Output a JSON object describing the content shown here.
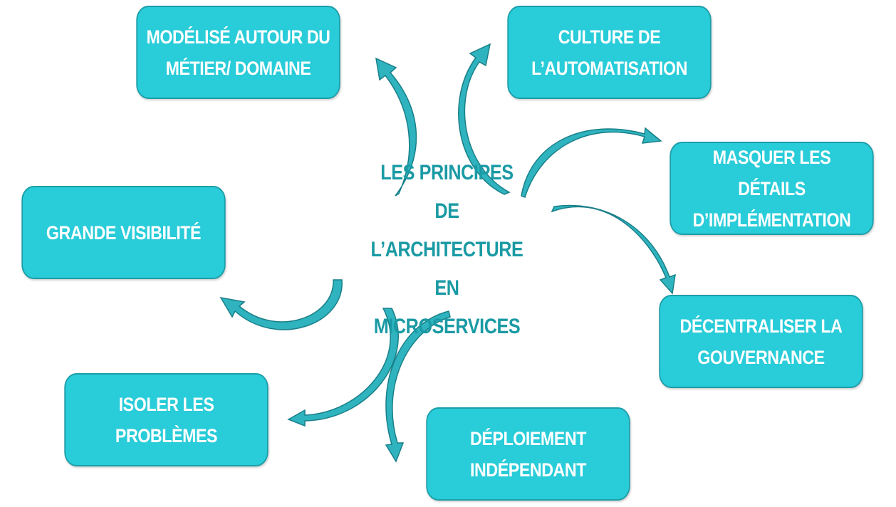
{
  "center": {
    "lines": [
      "LES PRINCIPES DE",
      "L’ARCHITECTURE EN",
      "MICROSERVICES"
    ]
  },
  "nodes": {
    "modelise": {
      "lines": [
        "MODÉLISÉ AUTOUR DU",
        "MÉTIER/ DOMAINE"
      ]
    },
    "culture": {
      "lines": [
        "CULTURE DE",
        "L’AUTOMATISATION"
      ]
    },
    "masquer": {
      "lines": [
        "MASQUER LES DÉTAILS",
        "D’IMPLÉMENTATION"
      ]
    },
    "grande": {
      "lines": [
        "GRANDE VISIBILITÉ"
      ]
    },
    "decentraliser": {
      "lines": [
        "DÉCENTRALISER LA",
        "GOUVERNANCE"
      ]
    },
    "isoler": {
      "lines": [
        "ISOLER LES PROBLÈMES"
      ]
    },
    "deploiement": {
      "lines": [
        "DÉPLOIEMENT",
        "INDÉPENDANT"
      ]
    }
  },
  "colors": {
    "box_fill": "#29ccd9",
    "box_border": "#1c9ea8",
    "center_text": "#1a9aa4",
    "arrow_fill": "#2fb4bf",
    "arrow_stroke": "#197f88"
  }
}
